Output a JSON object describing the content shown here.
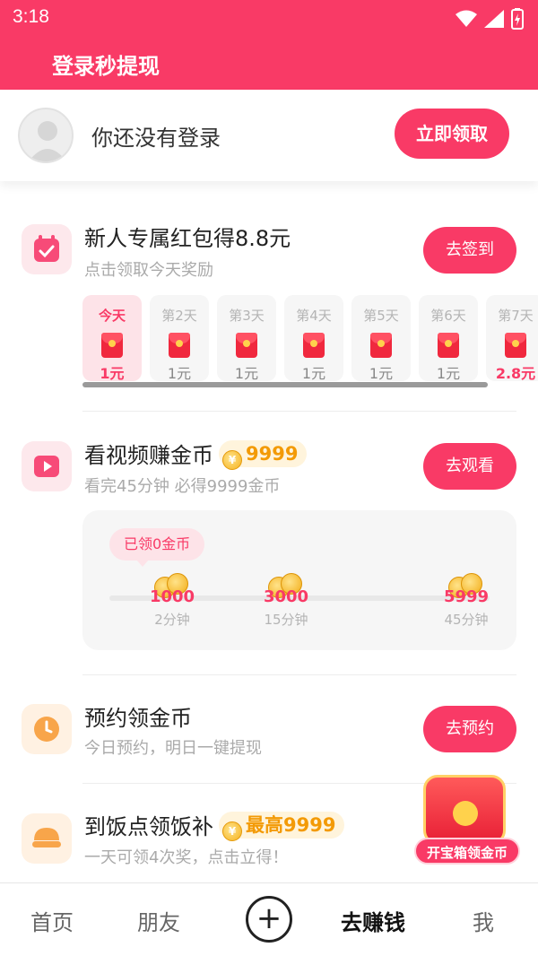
{
  "status_bar": {
    "time": "3:18"
  },
  "header": {
    "title": "登录秒提现"
  },
  "login": {
    "text": "你还没有登录",
    "button": "立即领取"
  },
  "tasks": [
    {
      "title": "新人专属红包得8.8元",
      "subtitle": "点击领取今天奖励",
      "button": "去签到",
      "icon": "calendar-check-icon"
    },
    {
      "title": "看视频赚金币",
      "coin_value": "9999",
      "subtitle": "看完45分钟 必得9999金币",
      "button": "去观看",
      "icon": "video-play-icon"
    },
    {
      "title": "预约领金币",
      "subtitle": "今日预约，明日一键提现",
      "button": "去预约",
      "icon": "clock-icon"
    },
    {
      "title": "到饭点领饭补",
      "coin_value": "最高9999",
      "subtitle": "一天可领4次奖，点击立得！",
      "icon": "meal-bowl-icon"
    }
  ],
  "checkin_days": [
    {
      "label": "今天",
      "amount": "1元"
    },
    {
      "label": "第2天",
      "amount": "1元"
    },
    {
      "label": "第3天",
      "amount": "1元"
    },
    {
      "label": "第4天",
      "amount": "1元"
    },
    {
      "label": "第5天",
      "amount": "1元"
    },
    {
      "label": "第6天",
      "amount": "1元"
    },
    {
      "label": "第7天",
      "amount": "2.8元"
    }
  ],
  "video_progress": {
    "claimed": "已领0金币",
    "milestones": [
      {
        "coins": "1000",
        "time": "2分钟"
      },
      {
        "coins": "3000",
        "time": "15分钟"
      },
      {
        "coins": "5999",
        "time": "45分钟"
      }
    ]
  },
  "treasure": {
    "label": "开宝箱领金币"
  },
  "bottom_nav": {
    "home": "首页",
    "friends": "朋友",
    "earn": "去赚钱",
    "me": "我"
  },
  "colors": {
    "brand": "#f93a66",
    "coin": "#f39a06"
  }
}
